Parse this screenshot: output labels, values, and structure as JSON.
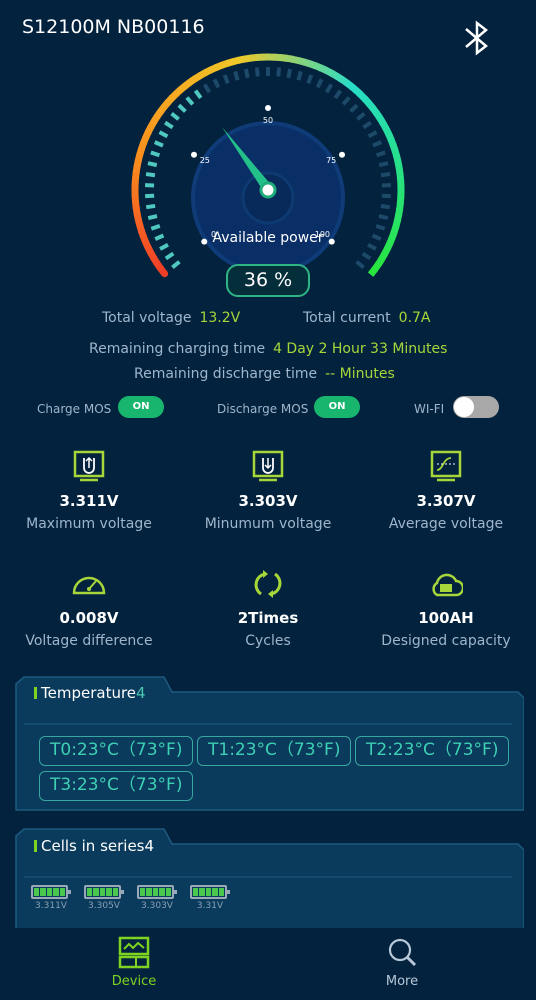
{
  "header": {
    "title": "S12100M NB00116",
    "bluetooth_icon": "bluetooth-icon"
  },
  "gauge": {
    "value": 36,
    "display": "36 %",
    "label": "Available power",
    "ticks": [
      "0",
      "25",
      "50",
      "75",
      "100"
    ]
  },
  "summary": {
    "total_voltage_label": "Total voltage",
    "total_voltage": "13.2V",
    "total_current_label": "Total current",
    "total_current": "0.7A",
    "charging_time_label": "Remaining charging time",
    "charging_time": "4 Day 2 Hour 33 Minutes",
    "discharge_time_label": "Remaining discharge time",
    "discharge_time": "-- Minutes"
  },
  "toggles": {
    "charge_mos_label": "Charge MOS",
    "charge_mos": "ON",
    "discharge_mos_label": "Discharge MOS",
    "discharge_mos": "ON",
    "wifi_label": "WI-FI",
    "wifi_on": false
  },
  "stats": [
    {
      "value": "3.311V",
      "label": "Maximum voltage",
      "icon": "max-voltage-icon"
    },
    {
      "value": "3.303V",
      "label": "Minumum voltage",
      "icon": "min-voltage-icon"
    },
    {
      "value": "3.307V",
      "label": "Average voltage",
      "icon": "average-voltage-icon"
    },
    {
      "value": "0.008V",
      "label": "Voltage difference",
      "icon": "gauge-icon"
    },
    {
      "value": "2Times",
      "label": "Cycles",
      "icon": "cycle-icon"
    },
    {
      "value": "100AH",
      "label": "Designed capacity",
      "icon": "cloud-capacity-icon"
    }
  ],
  "temperature": {
    "title": "Temperature",
    "count": "4",
    "sensors": [
      "T0:23°C（73°F)",
      "T1:23°C（73°F)",
      "T2:23°C（73°F)",
      "T3:23°C（73°F)"
    ]
  },
  "cells": {
    "title": "Cells in series",
    "count": "4",
    "voltages": [
      "3.311V",
      "3.305V",
      "3.303V",
      "3.31V"
    ]
  },
  "nav": {
    "device": "Device",
    "more": "More"
  },
  "colors": {
    "background": "#03223d",
    "accent": "#a6d63a",
    "on": "#18b56e",
    "teal": "#3ed0b4"
  }
}
